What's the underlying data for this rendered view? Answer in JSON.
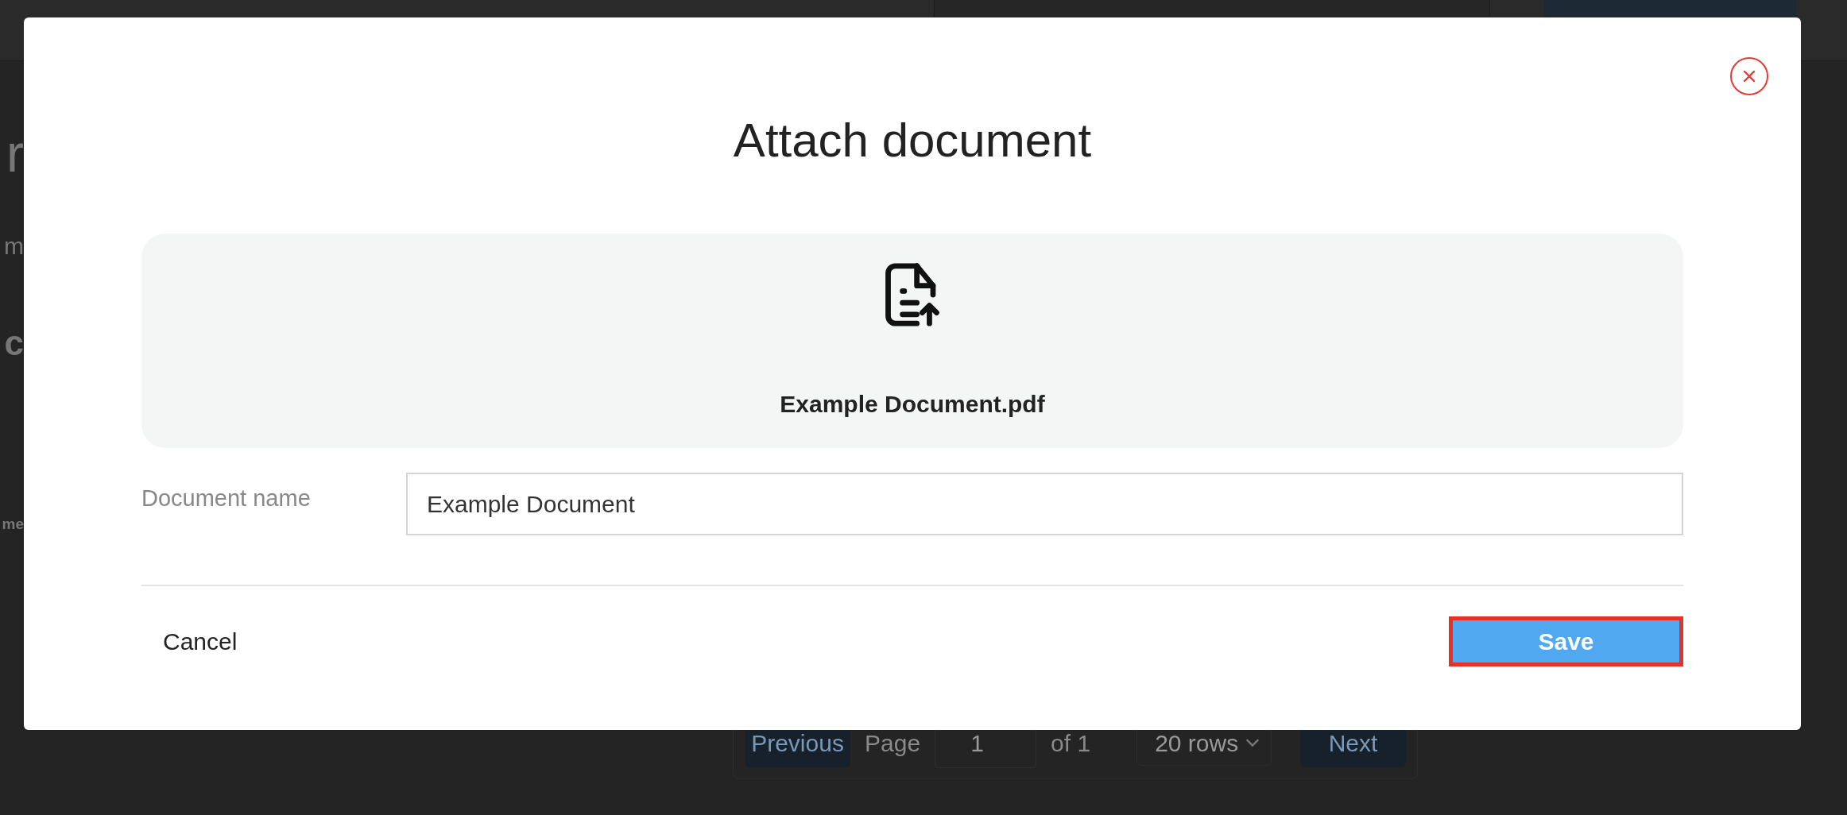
{
  "background_page": {
    "left_fragments": [
      "r",
      "m",
      "c",
      "me"
    ],
    "pagination": {
      "previous": "Previous",
      "page_label": "Page",
      "page_value": "1",
      "of_label": "of 1",
      "rows_select": "20 rows",
      "next": "Next"
    }
  },
  "dialog": {
    "title": "Attach document",
    "dropzone": {
      "file_name": "Example Document.pdf"
    },
    "field": {
      "label": "Document name",
      "value": "Example Document"
    },
    "cancel": "Cancel",
    "save": "Save",
    "save_highlighted": true
  }
}
